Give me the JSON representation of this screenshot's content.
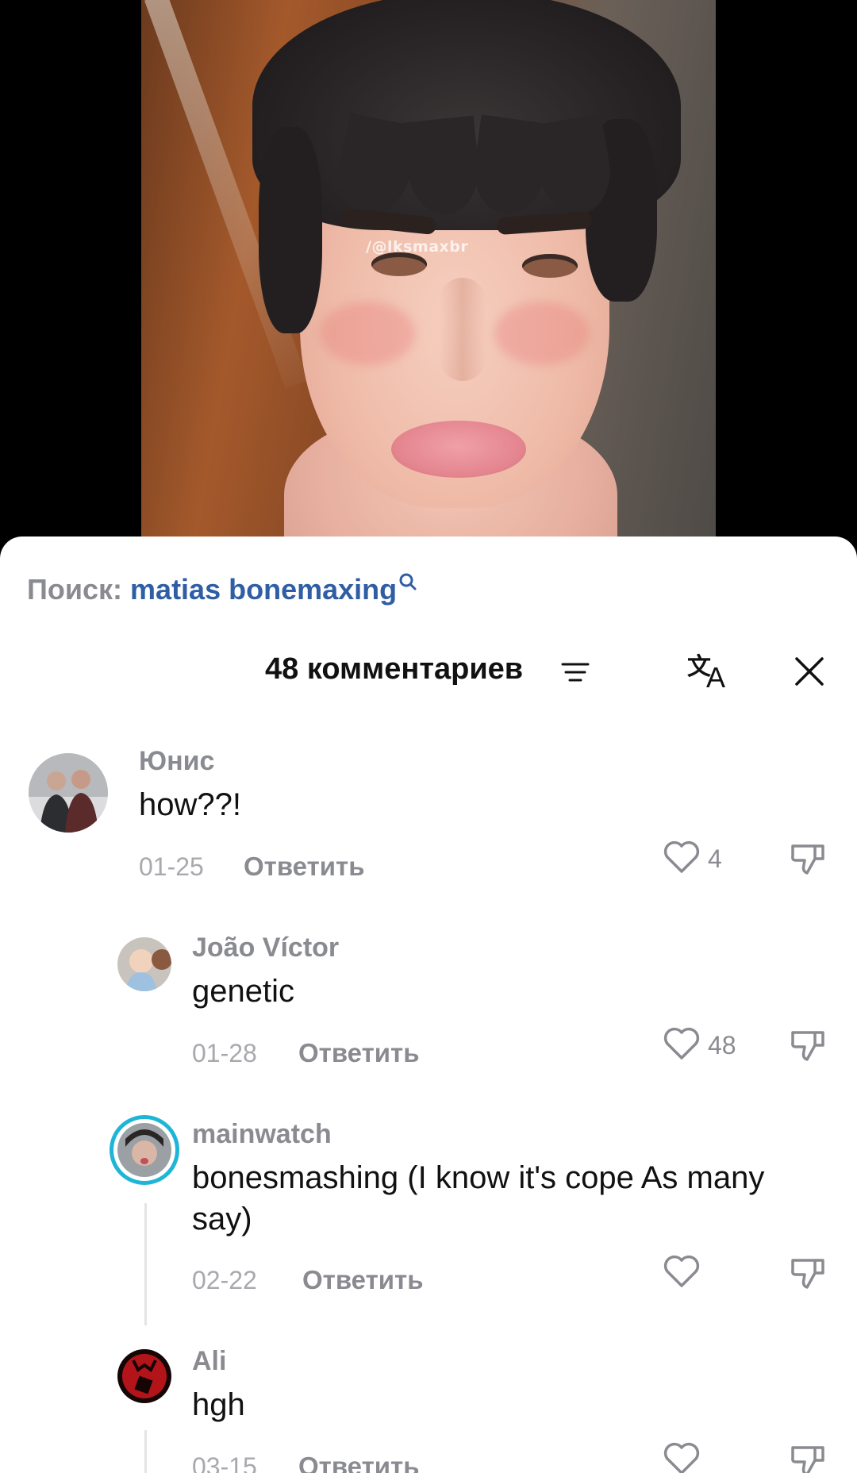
{
  "video": {
    "watermark": "/@lksmaxbr"
  },
  "search": {
    "prefix": "Поиск:",
    "query": "matias bonemaxing",
    "icon": "search-icon"
  },
  "header": {
    "title": "48 комментариев",
    "sort_icon": "sort-icon",
    "translate_icon": "translate-icon",
    "close_icon": "close-icon"
  },
  "comments": [
    {
      "user": "Юнис",
      "text": "how??!",
      "date": "01-25",
      "reply": "Ответить",
      "likes": "4",
      "level": 0
    },
    {
      "user": "João Víctor",
      "text": "genetic",
      "date": "01-28",
      "reply": "Ответить",
      "likes": "48",
      "level": 1
    },
    {
      "user": "mainwatch",
      "text": "bonesmashing (I know it's cope As many say)",
      "date": "02-22",
      "reply": "Ответить",
      "likes": "",
      "level": 1
    },
    {
      "user": "Ali",
      "text": "hgh",
      "date": "03-15",
      "reply": "Ответить",
      "likes": "",
      "level": 1
    }
  ],
  "colors": {
    "link_blue": "#2f5ea4",
    "muted_text": "#8a8b91",
    "story_ring": "#1fb5d6"
  }
}
